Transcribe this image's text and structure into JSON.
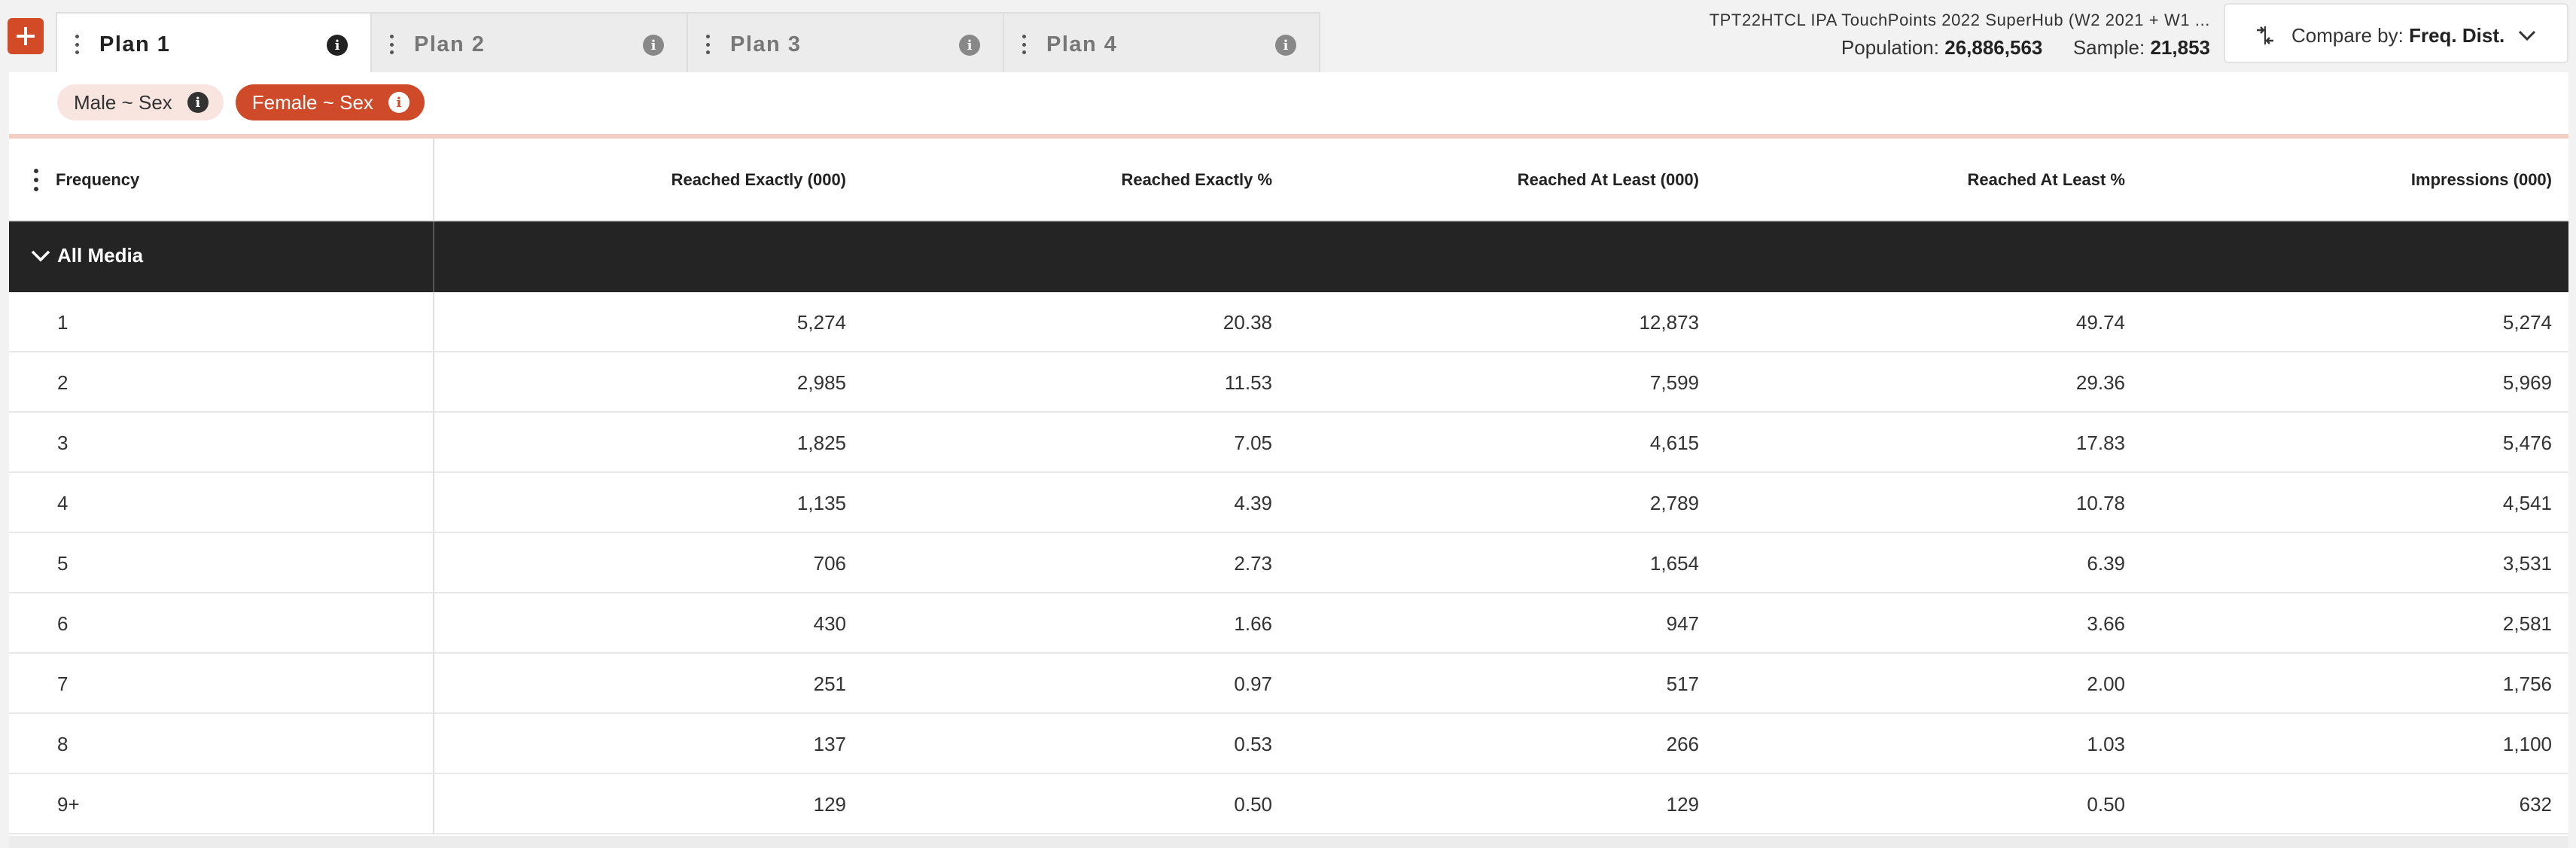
{
  "toolbar": {
    "add_label": "+"
  },
  "tabs": [
    {
      "label": "Plan 1",
      "active": true
    },
    {
      "label": "Plan 2",
      "active": false
    },
    {
      "label": "Plan 3",
      "active": false
    },
    {
      "label": "Plan 4",
      "active": false
    }
  ],
  "meta": {
    "survey": "TPT22HTCL IPA TouchPoints 2022 SuperHub (W2 2021 + W1 ...",
    "population_label": "Population:",
    "population_value": "26,886,563",
    "sample_label": "Sample:",
    "sample_value": "21,853"
  },
  "compare": {
    "label": "Compare by:",
    "value": "Freq. Dist."
  },
  "filters": [
    {
      "label": "Male ~ Sex",
      "active": false
    },
    {
      "label": "Female ~ Sex",
      "active": true
    }
  ],
  "table": {
    "columns": [
      "Frequency",
      "Reached Exactly (000)",
      "Reached Exactly %",
      "Reached At Least (000)",
      "Reached At Least %",
      "Impressions (000)"
    ],
    "group_label": "All Media",
    "rows": [
      [
        "1",
        "5,274",
        "20.38",
        "12,873",
        "49.74",
        "5,274"
      ],
      [
        "2",
        "2,985",
        "11.53",
        "7,599",
        "29.36",
        "5,969"
      ],
      [
        "3",
        "1,825",
        "7.05",
        "4,615",
        "17.83",
        "5,476"
      ],
      [
        "4",
        "1,135",
        "4.39",
        "2,789",
        "10.78",
        "4,541"
      ],
      [
        "5",
        "706",
        "2.73",
        "1,654",
        "6.39",
        "3,531"
      ],
      [
        "6",
        "430",
        "1.66",
        "947",
        "3.66",
        "2,581"
      ],
      [
        "7",
        "251",
        "0.97",
        "517",
        "2.00",
        "1,756"
      ],
      [
        "8",
        "137",
        "0.53",
        "266",
        "1.03",
        "1,100"
      ],
      [
        "9+",
        "129",
        "0.50",
        "129",
        "0.50",
        "632"
      ]
    ]
  },
  "colors": {
    "accent": "#d24a26",
    "group_row": "#242424",
    "chip_light": "#f8e5df"
  }
}
